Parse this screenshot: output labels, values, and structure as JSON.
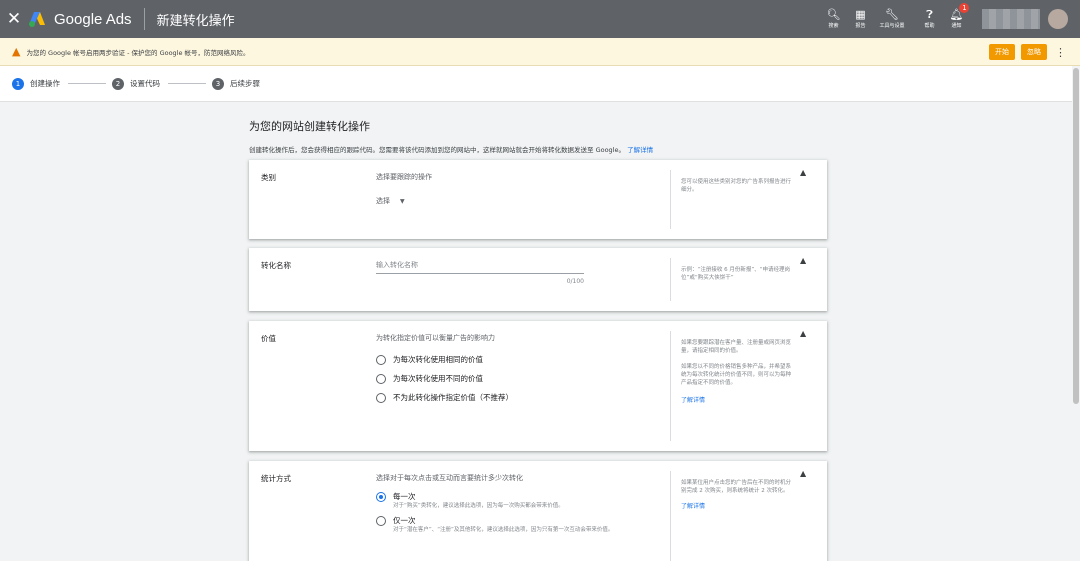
{
  "topbar": {
    "brand": "Google Ads",
    "page_title": "新建转化操作",
    "tools": [
      {
        "icon": "search-icon",
        "label": "搜索"
      },
      {
        "icon": "report-icon",
        "label": "报告"
      },
      {
        "icon": "wrench-icon",
        "label": "工具与设置"
      },
      {
        "icon": "help-icon",
        "label": "帮助"
      },
      {
        "icon": "bell-icon",
        "label": "通知",
        "badge": "1"
      }
    ]
  },
  "warning": {
    "text": "为您的 Google 帐号启用两步验证 - 保护您的 Google 帐号，防范网络风险。",
    "start_label": "开始",
    "dismiss_label": "忽略"
  },
  "steps": [
    {
      "num": "1",
      "label": "创建操作",
      "active": true
    },
    {
      "num": "2",
      "label": "设置代码",
      "active": false
    },
    {
      "num": "3",
      "label": "后续步骤",
      "active": false
    }
  ],
  "main": {
    "heading": "为您的网站创建转化操作",
    "subtitle": "创建转化操作后，您会获得相应的跟踪代码。您需要将该代码添加到您的网站中，这样就网站就会开始将转化数据发送至 Google。",
    "learn_more": "了解详情"
  },
  "cards": {
    "category": {
      "label": "类别",
      "prompt": "选择要跟踪的操作",
      "select_value": "选择",
      "help": "您可以使用这些类别对您的广告系列报告进行细分。"
    },
    "name": {
      "label": "转化名称",
      "placeholder": "输入转化名称",
      "counter": "0/100",
      "help": "示例：“注册接收 6 月份新报”、“申请经理岗位”或“购买大侠饼干”"
    },
    "value": {
      "label": "价值",
      "prompt": "为转化指定价值可以衡量广告的影响力",
      "options": [
        "为每次转化使用相同的价值",
        "为每次转化使用不同的价值",
        "不为此转化操作指定价值（不推荐）"
      ],
      "help1": "如果您要跟踪潜在客户量、注册量或网页浏览量，请指定相同的价值。",
      "help2": "如果您以不同的价格销售多种产品，并希望系统为每次转化统计的价值不同，则可以为每种产品指定不同的价值。",
      "help_link": "了解详情"
    },
    "counting": {
      "label": "统计方式",
      "prompt": "选择对于每次点击或互动而言要统计多少次转化",
      "options": [
        {
          "title": "每一次",
          "desc": "对于“购买”类转化，建议选择此选项，因为每一次购买都会带来价值。",
          "selected": true
        },
        {
          "title": "仅一次",
          "desc": "对于“潜在客户”、“注册”及其他转化，建议选择此选项，因为只有第一次互动会带来价值。",
          "selected": false
        }
      ],
      "help": "如果某位用户点击您的广告后在不同的时机分别完成 2 次购买，则系统将统计 2 次转化。",
      "help_link": "了解详情"
    }
  }
}
